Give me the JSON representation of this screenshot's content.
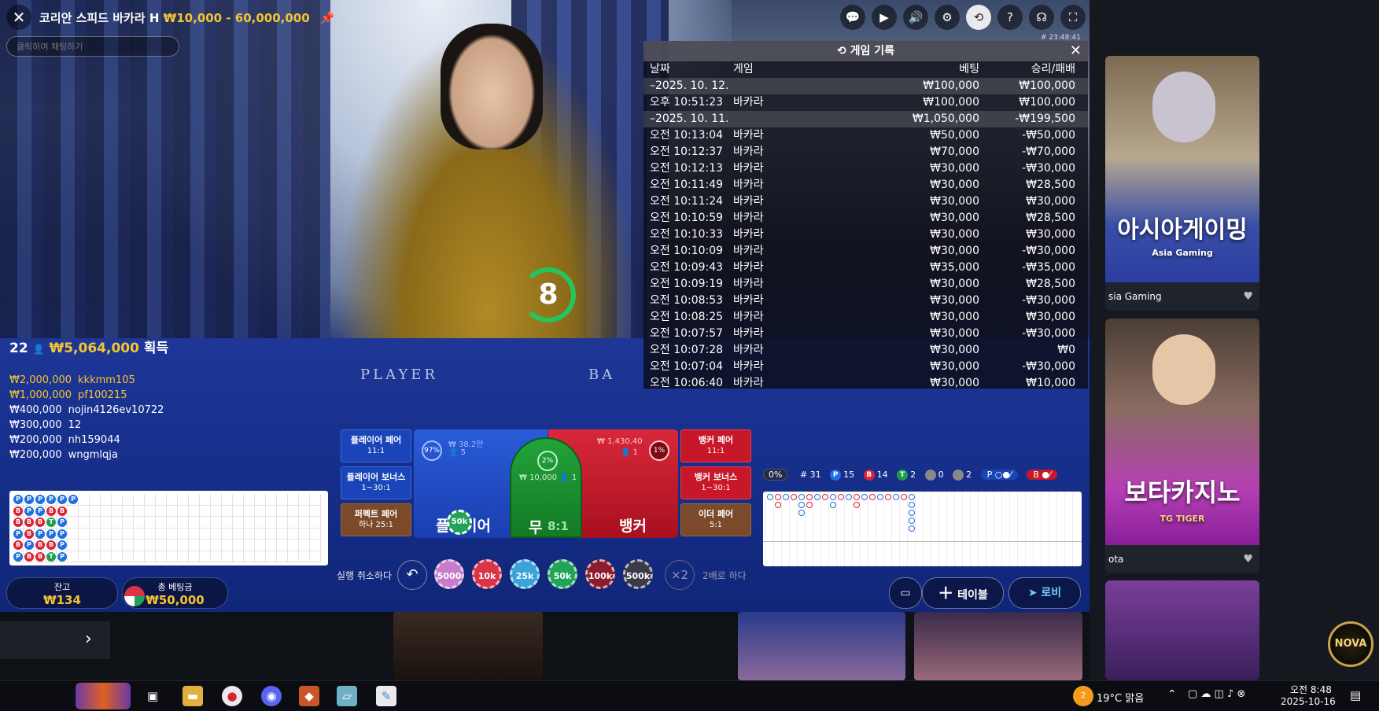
{
  "header": {
    "title": "코리안 스피드 바카라 H",
    "limits": "₩10,000 - 60,000,000",
    "chat_placeholder": "클릭하여 채팅하기",
    "round_id": "# 23:48:41",
    "timer": "8"
  },
  "history": {
    "title": "게임 기록",
    "columns": [
      "날짜",
      "게임",
      "베팅",
      "승리/패배"
    ],
    "rows": [
      {
        "time": "–2025. 10. 12.",
        "game": "",
        "bet": "₩100,000",
        "result": "₩100,000",
        "date": true
      },
      {
        "time": "오후 10:51:23",
        "game": "바카라",
        "bet": "₩100,000",
        "result": "₩100,000"
      },
      {
        "time": "–2025. 10. 11.",
        "game": "",
        "bet": "₩1,050,000",
        "result": "-₩199,500",
        "date": true
      },
      {
        "time": "오전 10:13:04",
        "game": "바카라",
        "bet": "₩50,000",
        "result": "-₩50,000"
      },
      {
        "time": "오전 10:12:37",
        "game": "바카라",
        "bet": "₩70,000",
        "result": "-₩70,000"
      },
      {
        "time": "오전 10:12:13",
        "game": "바카라",
        "bet": "₩30,000",
        "result": "-₩30,000"
      },
      {
        "time": "오전 10:11:49",
        "game": "바카라",
        "bet": "₩30,000",
        "result": "₩28,500"
      },
      {
        "time": "오전 10:11:24",
        "game": "바카라",
        "bet": "₩30,000",
        "result": "₩30,000"
      },
      {
        "time": "오전 10:10:59",
        "game": "바카라",
        "bet": "₩30,000",
        "result": "₩28,500"
      },
      {
        "time": "오전 10:10:33",
        "game": "바카라",
        "bet": "₩30,000",
        "result": "₩30,000"
      },
      {
        "time": "오전 10:10:09",
        "game": "바카라",
        "bet": "₩30,000",
        "result": "-₩30,000"
      },
      {
        "time": "오전 10:09:43",
        "game": "바카라",
        "bet": "₩35,000",
        "result": "-₩35,000"
      },
      {
        "time": "오전 10:09:19",
        "game": "바카라",
        "bet": "₩30,000",
        "result": "₩28,500"
      },
      {
        "time": "오전 10:08:53",
        "game": "바카라",
        "bet": "₩30,000",
        "result": "-₩30,000"
      },
      {
        "time": "오전 10:08:25",
        "game": "바카라",
        "bet": "₩30,000",
        "result": "₩30,000"
      },
      {
        "time": "오전 10:07:57",
        "game": "바카라",
        "bet": "₩30,000",
        "result": "-₩30,000"
      },
      {
        "time": "오전 10:07:28",
        "game": "바카라",
        "bet": "₩30,000",
        "result": "₩0"
      },
      {
        "time": "오전 10:07:04",
        "game": "바카라",
        "bet": "₩30,000",
        "result": "-₩30,000"
      },
      {
        "time": "오전 10:06:40",
        "game": "바카라",
        "bet": "₩30,000",
        "result": "₩10,000"
      }
    ]
  },
  "winners": {
    "count": "22",
    "amount": "₩5,064,000",
    "suffix": "획득",
    "list": [
      {
        "amount": "₩2,000,000",
        "name": "kkkmm105",
        "highlight": true
      },
      {
        "amount": "₩1,000,000",
        "name": "pf100215",
        "highlight": true
      },
      {
        "amount": "₩400,000",
        "name": "nojin4126ev10722",
        "highlight": false
      },
      {
        "amount": "₩300,000",
        "name": "12",
        "highlight": false
      },
      {
        "amount": "₩200,000",
        "name": "nh159044",
        "highlight": false
      },
      {
        "amount": "₩200,000",
        "name": "wngmlqja",
        "highlight": false
      }
    ]
  },
  "bead_road": {
    "columns": [
      [
        "P",
        "B",
        "B",
        "P",
        "B",
        "P"
      ],
      [
        "P",
        "P",
        "B",
        "B",
        "P",
        "B"
      ],
      [
        "P",
        "P",
        "B",
        "P",
        "B",
        "B"
      ],
      [
        "P",
        "B",
        "T",
        "P",
        "B",
        "T"
      ],
      [
        "P",
        "B",
        "P",
        "P",
        "P",
        "P"
      ],
      [
        "P"
      ]
    ]
  },
  "bets": {
    "player_pair": {
      "label": "플레이어 페어",
      "odds": "11:1"
    },
    "player_bonus": {
      "label": "플레이어 보너스",
      "odds": "1~30:1"
    },
    "perfect_pair": {
      "label": "퍼펙트 페어",
      "odds": "하나 25:1"
    },
    "banker_pair": {
      "label": "뱅커 페어",
      "odds": "11:1"
    },
    "banker_bonus": {
      "label": "뱅커 보너스",
      "odds": "1~30:1"
    },
    "either_pair": {
      "label": "이더 페어",
      "odds": "5:1"
    },
    "player": {
      "label": "플레이어",
      "pct": "97%",
      "total": "₩ 38.2만",
      "players": "5",
      "chip": "50k"
    },
    "tie": {
      "label": "무",
      "odds": "8:1",
      "pct": "2%",
      "total": "₩ 10,000",
      "players": "1"
    },
    "banker": {
      "label": "뱅커",
      "pct": "1%",
      "total": "₩ 1,430.40",
      "players": "1"
    }
  },
  "chips": {
    "cancel_label": "실행 취소하다",
    "values": [
      "5000",
      "10k",
      "25k",
      "50k",
      "100k",
      "500k"
    ],
    "colors": [
      "#c77dc9",
      "#d8344a",
      "#3aa3d9",
      "#21a35a",
      "#8b1d2e",
      "#3a3a48"
    ],
    "double_label": "2배로 하다",
    "double_icon": "×2"
  },
  "balance": {
    "label": "잔고",
    "value": "₩134"
  },
  "total_bet": {
    "label": "총 베팅금",
    "value": "₩50,000"
  },
  "stats": {
    "pct": "0%",
    "rounds": "# 31",
    "player": "15",
    "banker": "14",
    "tie": "2",
    "player_pair": "0",
    "banker_pair": "2",
    "player_badge": "P",
    "banker_badge": "B",
    "tie_badge": "T"
  },
  "buttons": {
    "table": "테이블",
    "lobby": "로비"
  },
  "lobby_cards": [
    {
      "name": "sia Gaming",
      "brand": "아시아게이밍",
      "sub": "Asia Gaming"
    },
    {
      "name": "ota",
      "brand": "보타카지노",
      "sub": "TG TIGER"
    }
  ],
  "nova_logo": "NOVA",
  "taskbar": {
    "weather": "19°C 맑음",
    "time": "오전 8:48",
    "date": "2025-10-16",
    "badge": "2"
  },
  "colors": {
    "gold": "#f4c431",
    "player": "#1f6fe0",
    "banker": "#d92335",
    "tie": "#1f9e4a"
  }
}
